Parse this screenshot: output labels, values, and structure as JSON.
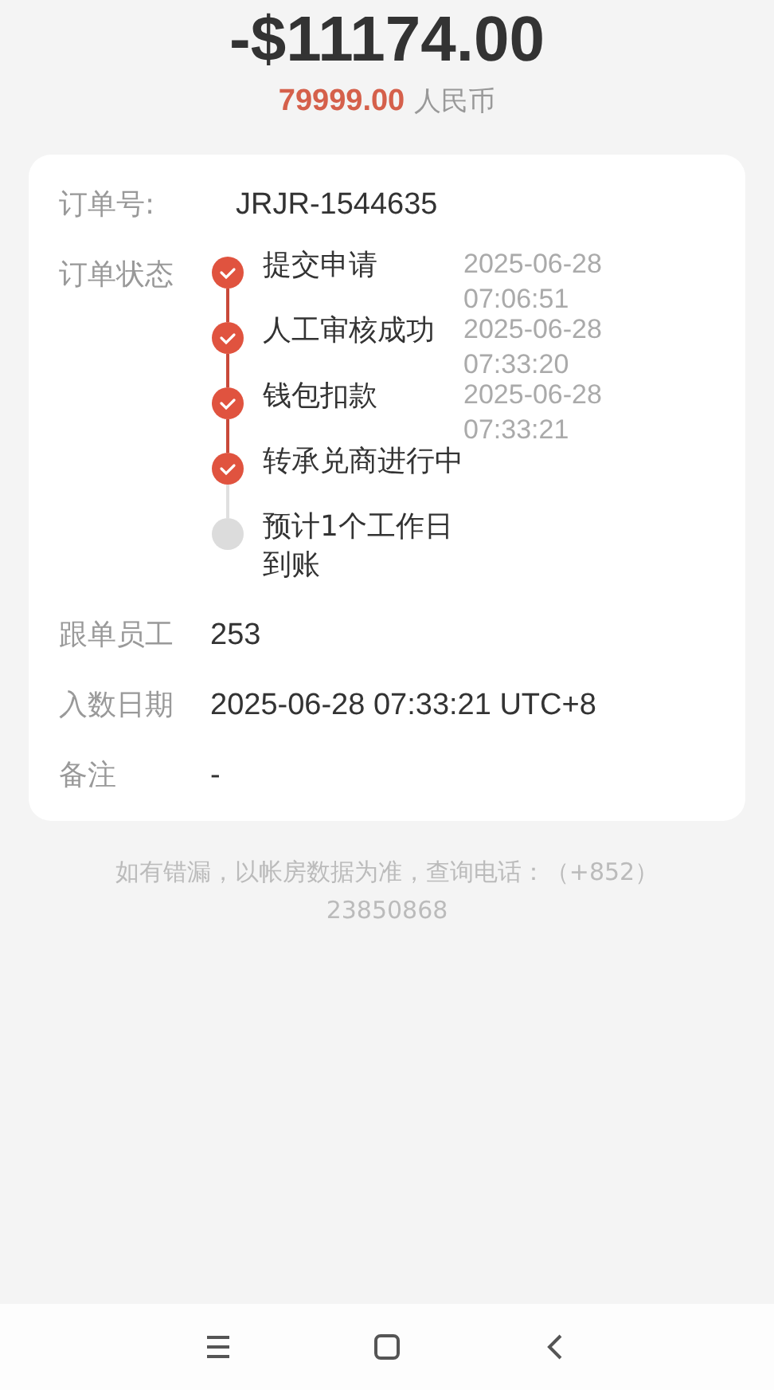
{
  "amount": "-$11174.00",
  "local_amount": {
    "value": "79999.00",
    "currency": "人民币"
  },
  "order": {
    "number_label": "订单号:",
    "number": "JRJR-1544635",
    "status_label": "订单状态",
    "steps": [
      {
        "title": "提交申请",
        "date": "2025-06-28",
        "time": "07:06:51",
        "done": true
      },
      {
        "title": "人工审核成功",
        "date": "2025-06-28",
        "time": "07:33:20",
        "done": true
      },
      {
        "title": "钱包扣款",
        "date": "2025-06-28",
        "time": "07:33:21",
        "done": true
      },
      {
        "title": "转承兑商进行中",
        "done": true
      },
      {
        "title": "预计1个工作日到账",
        "done": false
      }
    ],
    "fields": [
      {
        "label": "跟单员工",
        "value": "253"
      },
      {
        "label": "入数日期",
        "value": "2025-06-28 07:33:21 UTC+8"
      },
      {
        "label": "备注",
        "value": "-"
      }
    ]
  },
  "footer": {
    "note": "如有错漏，以帐房数据为准，查询电话：（+852）",
    "phone": "23850868"
  }
}
